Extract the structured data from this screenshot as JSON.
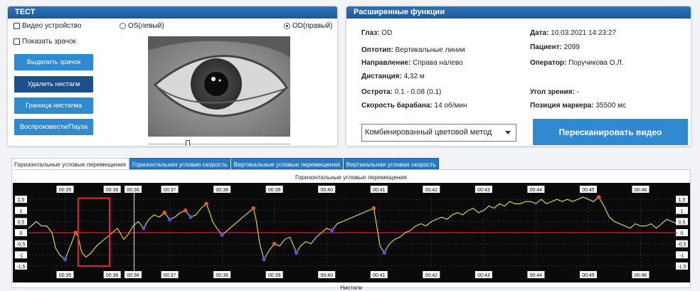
{
  "left_panel": {
    "title": "ТЕСТ",
    "video_device_label": "Видео устройство",
    "show_pupil_label": "Показать зрачок",
    "radio_os": "OS(левый)",
    "radio_od": "OD(правый)",
    "buttons": [
      "Выделить зрачок",
      "Удалить нистагм",
      "Граница нистагма",
      "Воспроизвести/Пауза"
    ]
  },
  "right_panel": {
    "title": "Расширенные функции",
    "fields": [
      {
        "label": "Глаз:",
        "value": " OD"
      },
      {
        "label": "Оптотип:",
        "value": "  Вертикальные линии"
      },
      {
        "label": "Направление:",
        "value": " Справа налево"
      },
      {
        "label": "Дистанция:",
        "value": " 4,32 м"
      },
      {
        "label": "Острота:",
        "value": " 0.1 - 0.08 (0.1)"
      },
      {
        "label": "Скорость барабана:",
        "value": " 14 об/мин"
      },
      {
        "label": "Дата:",
        "value": " 10.03.2021 14:23:27"
      },
      {
        "label": "Пациент:",
        "value": " 2099"
      },
      {
        "label": "Оператор:",
        "value": " Поручикова О.Л."
      },
      {
        "label": "Угол зрения:",
        "value": " -"
      },
      {
        "label": "Позиция маркера:",
        "value": " 35500 мс"
      }
    ],
    "color_method": "Комбинированный цветовой метод",
    "rescan_label": "Пересканировать видео"
  },
  "tabs": [
    "Горизонтальные угловые перемещения",
    "Горизонтальная угловая скорость",
    "Вертикальные угловые перемещения",
    "Вертикальная угловая скорость"
  ],
  "colors": {
    "header": "#2f73b8",
    "button": "#2f8ad0",
    "button_dark": "#1c4f8c",
    "trace": "#e8e23c",
    "zero_line": "#d62020",
    "selection": "#e02a2a",
    "marker_red": "#f0522a",
    "marker_blue": "#4a56d8"
  },
  "chart_data": {
    "type": "line",
    "title": "Горизонтальные угловые перемещения",
    "xlabel": "Нистагм",
    "time_ticks": [
      "00:35",
      "00:36",
      "00:36",
      "00:37",
      "00:38",
      "00:39",
      "00:40",
      "00:41",
      "00:42",
      "00:43",
      "00:44",
      "00:45",
      "00:46"
    ],
    "y_ticks": [
      "1,5",
      "1",
      "0,5",
      "0",
      "-0,5",
      "-1",
      "-1,5"
    ],
    "ylim": [
      -1.6,
      1.6
    ],
    "xlim": [
      34.3,
      46.7
    ],
    "series": [
      {
        "x": [
          34.3,
          34.45,
          34.55,
          34.65,
          34.75,
          34.82,
          34.9,
          35.0,
          35.1,
          35.2,
          35.25,
          35.32,
          35.4,
          35.5,
          35.6,
          35.7,
          35.8,
          35.9,
          36.0,
          36.05,
          36.12,
          36.2,
          36.3,
          36.4,
          36.5,
          36.6,
          36.7,
          36.8,
          36.9,
          37.0,
          37.1,
          37.2,
          37.3,
          37.4,
          37.5,
          37.6,
          37.7,
          37.75,
          37.82,
          37.9,
          38.0,
          38.1,
          38.2,
          38.3,
          38.4,
          38.5,
          38.6,
          38.65,
          38.72,
          38.8,
          38.9,
          39.0,
          39.1,
          39.2,
          39.3,
          39.35,
          39.42,
          39.5,
          39.6,
          39.7,
          39.8,
          39.9,
          40.0,
          40.1,
          40.2,
          40.3,
          40.4,
          40.5,
          40.6,
          40.7,
          40.8,
          40.9,
          40.95,
          41.02,
          41.1,
          41.2,
          41.3,
          41.4,
          41.5,
          41.6,
          41.7,
          41.8,
          41.9,
          42.0,
          42.1,
          42.2,
          42.3,
          42.4,
          42.5,
          42.6,
          42.7,
          42.8,
          42.9,
          43.0,
          43.1,
          43.2,
          43.3,
          43.4,
          43.5,
          43.6,
          43.7,
          43.8,
          43.9,
          44.0,
          44.1,
          44.2,
          44.3,
          44.4,
          44.5,
          44.6,
          44.7,
          44.8,
          44.9,
          45.0,
          45.1,
          45.2,
          45.3,
          45.4,
          45.5,
          45.6,
          45.7,
          45.8,
          45.9,
          46.0,
          46.1,
          46.2,
          46.3,
          46.4,
          46.5,
          46.6,
          46.7
        ],
        "y": [
          0.2,
          0.5,
          0.3,
          0.3,
          0.0,
          -0.7,
          -1.0,
          -1.2,
          -0.6,
          0.0,
          -0.2,
          -0.9,
          -1.1,
          -0.9,
          -0.6,
          -0.4,
          -0.2,
          0.0,
          0.2,
          0.0,
          -0.3,
          -0.1,
          0.3,
          0.5,
          0.2,
          0.6,
          0.8,
          0.7,
          0.9,
          0.6,
          0.7,
          0.9,
          1.0,
          0.7,
          0.8,
          1.1,
          1.3,
          1.0,
          0.5,
          0.2,
          -0.1,
          0.1,
          0.3,
          0.5,
          0.7,
          0.9,
          1.1,
          0.6,
          -0.5,
          -1.2,
          -0.8,
          -0.5,
          -0.6,
          -0.3,
          -0.2,
          -0.5,
          -0.9,
          -0.6,
          -0.4,
          -0.5,
          -0.2,
          0.0,
          0.2,
          0.1,
          0.4,
          0.5,
          0.6,
          0.7,
          0.8,
          0.9,
          1.0,
          1.1,
          0.4,
          -0.6,
          -0.9,
          -0.5,
          -0.3,
          -0.2,
          0.0,
          0.1,
          0.3,
          0.4,
          0.3,
          0.5,
          0.6,
          0.7,
          0.6,
          0.8,
          0.9,
          0.8,
          1.0,
          1.1,
          0.9,
          1.0,
          1.2,
          1.1,
          1.3,
          1.2,
          1.4,
          1.3,
          1.3,
          1.4,
          1.4,
          1.3,
          1.5,
          1.3,
          1.4,
          1.5,
          1.4,
          1.5,
          1.4,
          1.5,
          1.6,
          1.5,
          1.4,
          1.6,
          1.2,
          0.7,
          0.5,
          0.4,
          0.3,
          0.2,
          0.4,
          0.3,
          0.3,
          0.4,
          0.2,
          0.4,
          0.6,
          0.5,
          0.4
        ]
      }
    ],
    "marker_x": 35.5,
    "selection": {
      "x0": 35.25,
      "x1": 35.85,
      "y0": -1.5,
      "y1": 1.55
    }
  }
}
